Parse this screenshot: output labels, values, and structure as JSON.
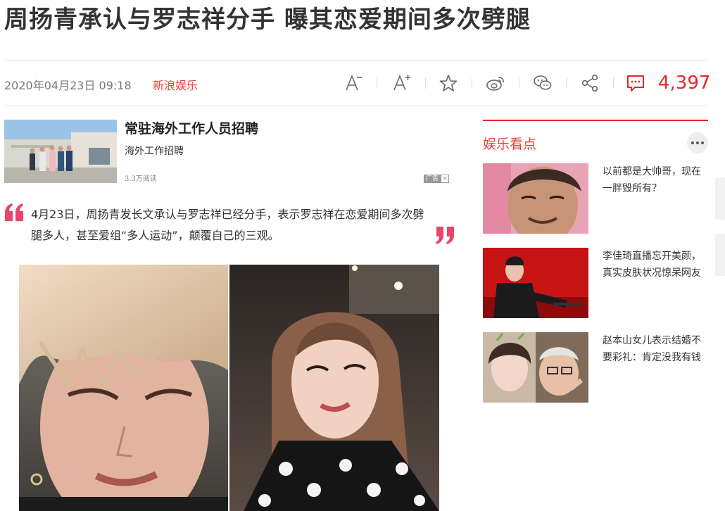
{
  "article": {
    "title": "周扬青承认与罗志祥分手 曝其恋爱期间多次劈腿",
    "date": "2020年04月23日 09:18",
    "source": "新浪娱乐",
    "comment_count": "4,397",
    "quote": "4月23日，周扬青发长文承认与罗志祥已经分手，表示罗志祥在恋爱期间多次劈腿多人，甚至爱组“多人运动”，颠覆自己的三观。"
  },
  "toolbar": {
    "icons": [
      "font-decrease-icon",
      "font-increase-icon",
      "star-icon",
      "weibo-icon",
      "wechat-icon",
      "share-icon",
      "comment-icon"
    ],
    "accent": "#e8252a"
  },
  "ad": {
    "title": "常驻海外工作人员招聘",
    "subtitle": "海外工作招聘",
    "reads": "3.3万阅读",
    "badge": "广告"
  },
  "sidebar": {
    "heading": "娱乐看点",
    "items": [
      {
        "text": "以前都是大帅哥，现在一胖毁所有？"
      },
      {
        "text": "李佳琦直播忘开美颜，真实皮肤状况惊呆网友"
      },
      {
        "text": "赵本山女儿表示结婚不要彩礼：肯定没我有钱"
      }
    ]
  }
}
